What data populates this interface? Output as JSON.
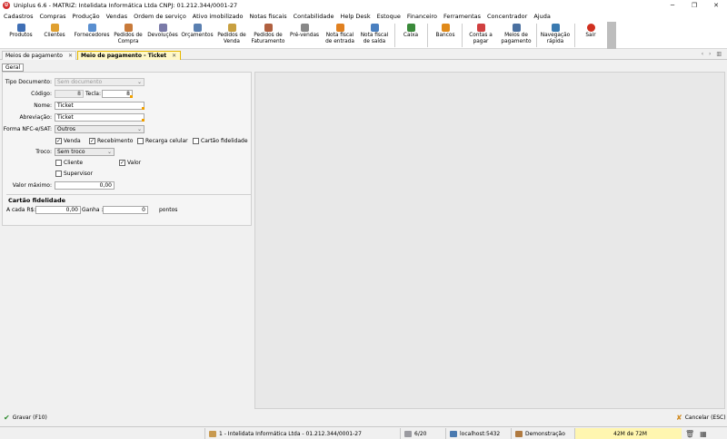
{
  "window": {
    "title": "Uniplus 6.6 - MATRIZ: Intelidata Informática Ltda CNPJ: 01.212.344/0001-27",
    "controls": [
      "─",
      "❐",
      "✕"
    ]
  },
  "menu": [
    "Cadastros",
    "Compras",
    "Produção",
    "Vendas",
    "Ordem de serviço",
    "Ativo imobilizado",
    "Notas fiscais",
    "Contabilidade",
    "Help Desk",
    "Estoque",
    "Financeiro",
    "Ferramentas",
    "Concentrador",
    "Ajuda"
  ],
  "toolbar": [
    {
      "label": "Produtos",
      "icon": "box-icon",
      "color": "#3f6fb5"
    },
    {
      "label": "Clientes",
      "icon": "person-icon",
      "color": "#e0a030"
    },
    {
      "label": "Fornecedores",
      "icon": "truck-icon",
      "color": "#5a8fd0"
    },
    {
      "label": "Pedidos de\nCompra",
      "icon": "cart-icon",
      "color": "#c87a3a"
    },
    {
      "label": "Devoluções",
      "icon": "return-icon",
      "color": "#7a7aa8"
    },
    {
      "label": "Orçamentos",
      "icon": "calc-icon",
      "color": "#5a7fb0"
    },
    {
      "label": "Pedidos de\nVenda",
      "icon": "order-icon",
      "color": "#c8a040"
    },
    {
      "label": "Pedidos de\nFaturamento",
      "icon": "invoice-icon",
      "color": "#b06040"
    },
    {
      "label": "Pré-vendas",
      "icon": "cart-icon",
      "color": "#888888"
    },
    {
      "label": "Nota fiscal\nde entrada",
      "icon": "note-in-icon",
      "color": "#e08020"
    },
    {
      "label": "Nota fiscal\nde saída",
      "icon": "note-out-icon",
      "color": "#4a80c0"
    },
    {
      "label": "Caixa",
      "icon": "cashbox-icon",
      "color": "#3a8a3a"
    },
    {
      "label": "Bancos",
      "icon": "bank-icon",
      "color": "#e08a1a"
    },
    {
      "label": "Contas a\npagar",
      "icon": "payable-icon",
      "color": "#d04040"
    },
    {
      "label": "Meios de\npagamento",
      "icon": "card-icon",
      "color": "#4a70a0"
    },
    {
      "label": "Navegação\nrápida",
      "icon": "navigation-icon",
      "color": "#3a7ab0"
    },
    {
      "label": "Sair",
      "icon": "power-icon",
      "color": "#d03020"
    }
  ],
  "tabs": [
    {
      "label": "Meios de pagamento",
      "close": "✕"
    },
    {
      "label": "Meio de pagamento - Ticket",
      "close": "✕"
    }
  ],
  "tab_nav": "‹ › ▥",
  "subtab": "Geral",
  "form": {
    "tipo_documento": {
      "label": "Tipo Documento:",
      "value": "Sem documento"
    },
    "codigo": {
      "label": "Código:",
      "value": "8"
    },
    "tecla": {
      "label": "Tecla:",
      "value": "8"
    },
    "nome": {
      "label": "Nome:",
      "value": "Ticket"
    },
    "abreviacao": {
      "label": "Abreviação:",
      "value": "Ticket"
    },
    "forma_nfce": {
      "label": "Forma NFC-e/SAT:",
      "value": "Outros"
    },
    "checks_row1": [
      {
        "label": "Venda",
        "checked": true
      },
      {
        "label": "Recebimento",
        "checked": true
      },
      {
        "label": "Recarga celular",
        "checked": false
      },
      {
        "label": "Cartão fidelidade",
        "checked": false
      }
    ],
    "troco": {
      "label": "Troco:",
      "value": "Sem troco"
    },
    "cliente": {
      "label": "Cliente",
      "checked": false
    },
    "valor": {
      "label": "Valor",
      "checked": true
    },
    "supervisor": {
      "label": "Supervisor",
      "checked": false
    },
    "valor_maximo": {
      "label": "Valor máximo:",
      "value": "0,00"
    },
    "fidelidade_title": "Cartão fidelidade",
    "a_cada": {
      "label": "A cada R$:",
      "value": "0,00"
    },
    "ganha": {
      "label": "Ganha :",
      "value": "0"
    },
    "pontos": "pontos"
  },
  "footer": {
    "save": "Gravar (F10)",
    "cancel": "Cancelar (ESC)"
  },
  "status": {
    "company": "1 - Intelidata Informática Ltda - 01.212.344/0001-27",
    "page": "6/20",
    "server": "localhost:5432",
    "user": "Demonstração",
    "memory": "42M de 72M"
  }
}
